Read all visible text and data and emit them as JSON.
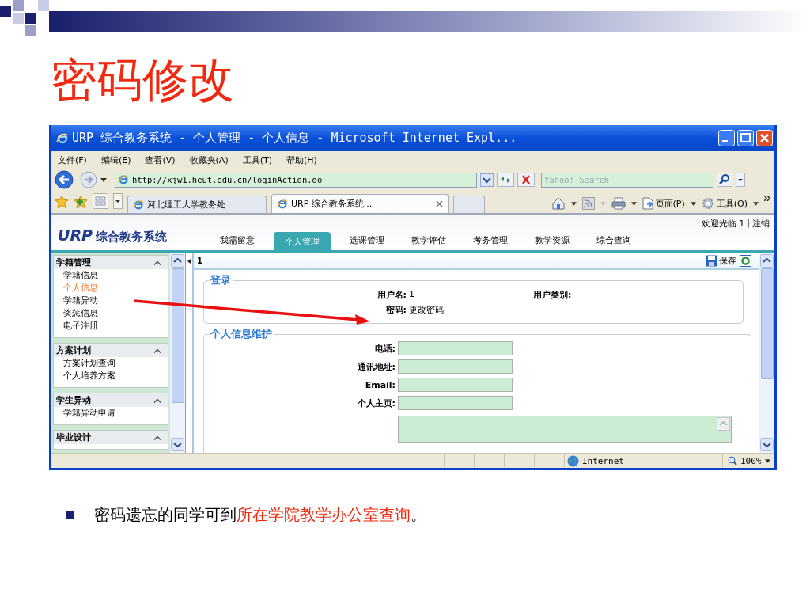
{
  "slide": {
    "title": "密码修改",
    "bullet": [
      {
        "text": "密码遗忘的同学可到",
        "highlight": false
      },
      {
        "text": "所在学院教学办公室查询",
        "highlight": true
      },
      {
        "text": "。",
        "highlight": false
      }
    ]
  },
  "window": {
    "title": "URP 综合教务系统 - 个人管理 - 个人信息 - Microsoft Internet Expl..."
  },
  "menu": [
    "文件(F)",
    "编辑(E)",
    "查看(V)",
    "收藏夹(A)",
    "工具(T)",
    "帮助(H)"
  ],
  "address": {
    "url": "http://xjw1.heut.edu.cn/loginAction.do"
  },
  "search": {
    "placeholder": "Yahoo! Search"
  },
  "tabs": [
    {
      "label": "河北理工大学教务处",
      "selected": false
    },
    {
      "label": "URP 综合教务系统...",
      "selected": true
    }
  ],
  "command_bar": {
    "page": "页面(P)",
    "tools": "工具(O)"
  },
  "page": {
    "logo": "URP",
    "logo_text": "综合教务系统",
    "welcome": "欢迎光临 1",
    "separator": "|",
    "logout": "注销",
    "nav": [
      {
        "label": "我需留意",
        "selected": false
      },
      {
        "label": "个人管理",
        "selected": true
      },
      {
        "label": "选课管理",
        "selected": false
      },
      {
        "label": "教学评估",
        "selected": false
      },
      {
        "label": "考务管理",
        "selected": false
      },
      {
        "label": "教学资源",
        "selected": false
      },
      {
        "label": "综合查询",
        "selected": false
      }
    ],
    "sidebar": [
      {
        "title": "学籍管理",
        "items": [
          {
            "label": "学籍信息",
            "selected": false
          },
          {
            "label": "个人信息",
            "selected": true
          },
          {
            "label": "学籍异动",
            "selected": false
          },
          {
            "label": "奖惩信息",
            "selected": false
          },
          {
            "label": "电子注册",
            "selected": false
          }
        ]
      },
      {
        "title": "方案计划",
        "items": [
          {
            "label": "方案计划查询",
            "selected": false
          },
          {
            "label": "个人培养方案",
            "selected": false
          }
        ]
      },
      {
        "title": "学生异动",
        "items": [
          {
            "label": "学籍异动申请",
            "selected": false
          }
        ]
      },
      {
        "title": "毕业设计"
      }
    ],
    "toolbar": {
      "page_number": "1",
      "save": "保存"
    },
    "login": {
      "legend": "登录",
      "username_label": "用户名:",
      "username": "1",
      "user_type_label": "用户类别:",
      "password_label": "密码:",
      "password_link": "更改密码"
    },
    "personal": {
      "legend": "个人信息维护",
      "fields": [
        {
          "label": "电话:"
        },
        {
          "label": "通讯地址:"
        },
        {
          "label": "Email:"
        },
        {
          "label": "个人主页:"
        }
      ]
    }
  },
  "status_bar": {
    "zone": "Internet",
    "zoom": "100%"
  }
}
